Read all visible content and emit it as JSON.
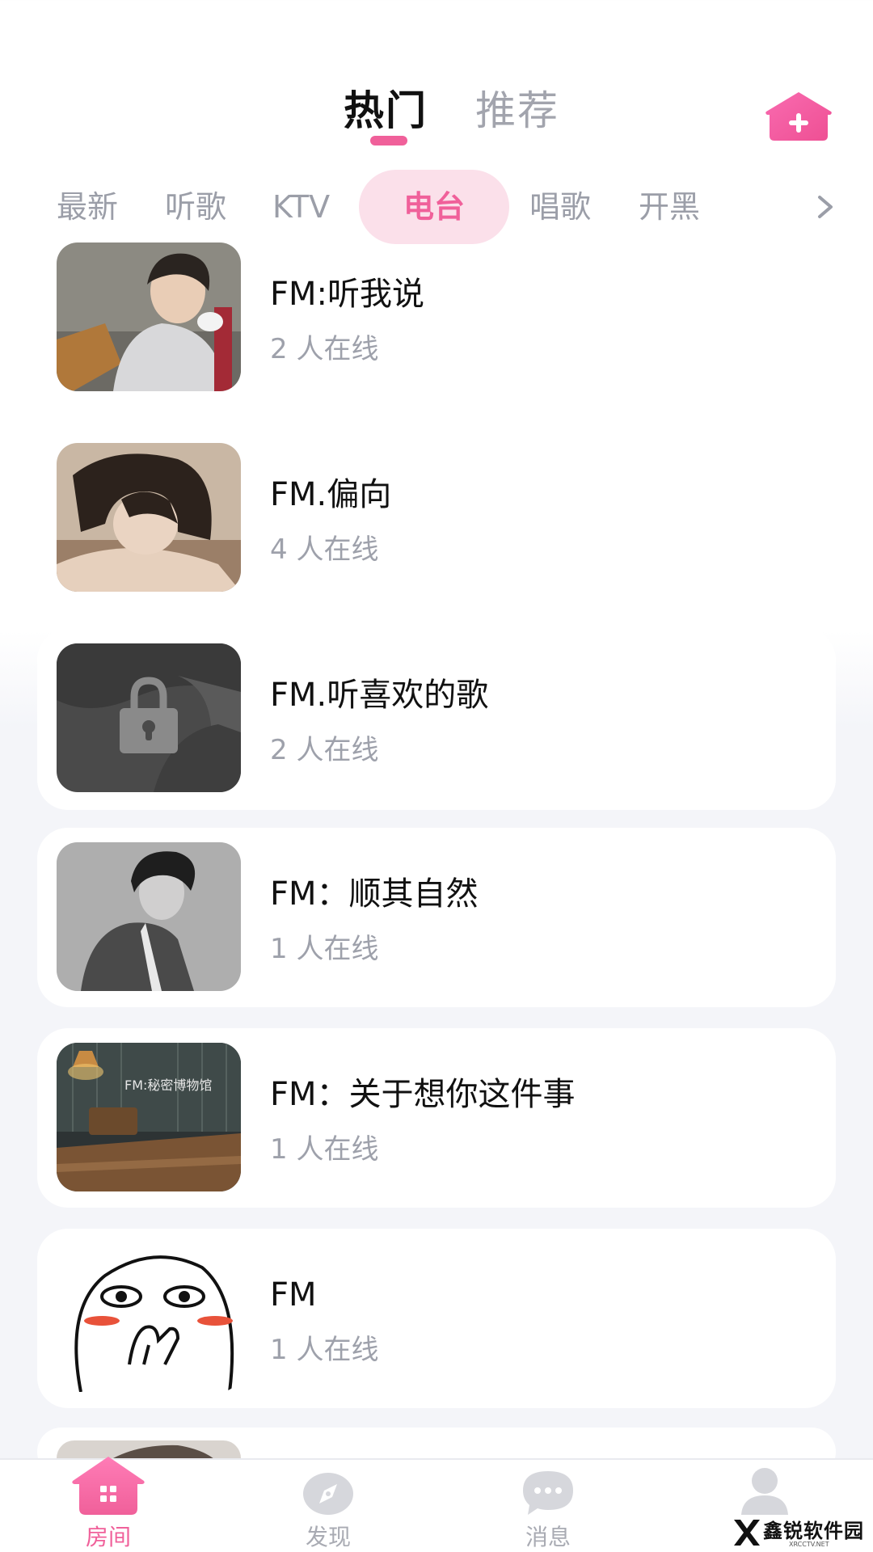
{
  "header": {
    "tabs": [
      {
        "label": "热门",
        "active": true
      },
      {
        "label": "推荐",
        "active": false
      }
    ],
    "add_room_icon": "add-room-house-icon"
  },
  "categories": {
    "items": [
      {
        "label": "最新",
        "active": false
      },
      {
        "label": "听歌",
        "active": false
      },
      {
        "label": "KTV",
        "active": false
      },
      {
        "label": "电台",
        "active": true
      },
      {
        "label": "唱歌",
        "active": false
      },
      {
        "label": "开黑",
        "active": false
      }
    ],
    "more_icon": "chevron-right-icon"
  },
  "rooms": [
    {
      "name": "FM:听我说",
      "online": "2 人在线"
    },
    {
      "name": "FM.偏向",
      "online": "4 人在线"
    },
    {
      "name": "FM.听喜欢的歌",
      "online": "2 人在线",
      "locked": true
    },
    {
      "name": "FM：顺其自然",
      "online": "1 人在线"
    },
    {
      "name": "FM：关于想你这件事",
      "online": "1 人在线",
      "thumb_text": "FM:秘密博物馆"
    },
    {
      "name": "FM",
      "online": "1 人在线"
    }
  ],
  "bottom_nav": {
    "items": [
      {
        "label": "房间",
        "icon": "home-icon",
        "active": true
      },
      {
        "label": "发现",
        "icon": "compass-icon",
        "active": false
      },
      {
        "label": "消息",
        "icon": "chat-bubble-icon",
        "active": false
      },
      {
        "label": "",
        "icon": "user-icon",
        "active": false
      }
    ]
  },
  "watermark": {
    "text": "鑫锐软件园",
    "sub": "XRCCTV.NET"
  },
  "colors": {
    "accent": "#f0609a",
    "accent_light": "#fbe0ea",
    "muted": "#9ea1ab",
    "bg": "#f4f5f9"
  }
}
